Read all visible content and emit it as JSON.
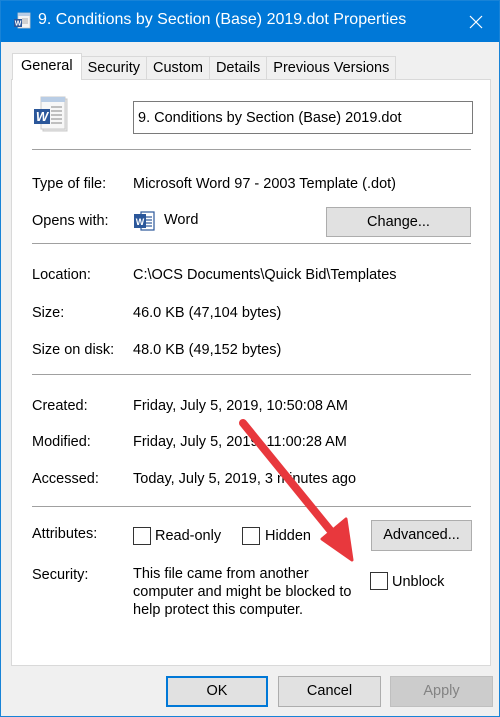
{
  "window": {
    "title": "9. Conditions by Section (Base) 2019.dot Properties",
    "app_icon": "word-document-icon",
    "close_icon": "close-icon"
  },
  "tabs": [
    {
      "label": "General",
      "active": true
    },
    {
      "label": "Security",
      "active": false
    },
    {
      "label": "Custom",
      "active": false
    },
    {
      "label": "Details",
      "active": false
    },
    {
      "label": "Previous Versions",
      "active": false
    }
  ],
  "general": {
    "file_name": "9. Conditions by Section (Base) 2019.dot",
    "type_of_file": {
      "label": "Type of file:",
      "value": "Microsoft Word 97 - 2003 Template (.dot)"
    },
    "opens_with": {
      "label": "Opens with:",
      "value": "Word",
      "change_button": "Change..."
    },
    "location": {
      "label": "Location:",
      "value": "C:\\OCS Documents\\Quick Bid\\Templates"
    },
    "size": {
      "label": "Size:",
      "value": "46.0 KB (47,104 bytes)"
    },
    "size_on_disk": {
      "label": "Size on disk:",
      "value": "48.0 KB (49,152 bytes)"
    },
    "created": {
      "label": "Created:",
      "value": "Friday, July 5, 2019, 10:50:08 AM"
    },
    "modified": {
      "label": "Modified:",
      "value": "Friday, July 5, 2019, 11:00:28 AM"
    },
    "accessed": {
      "label": "Accessed:",
      "value": "Today, July 5, 2019, 3 minutes ago"
    },
    "attributes": {
      "label": "Attributes:",
      "read_only": {
        "label": "Read-only",
        "checked": false
      },
      "hidden": {
        "label": "Hidden",
        "checked": false
      },
      "advanced_button": "Advanced..."
    },
    "security": {
      "label": "Security:",
      "text": "This file came from another computer and might be blocked to help protect this computer.",
      "unblock": {
        "label": "Unblock",
        "checked": false
      }
    }
  },
  "footer": {
    "ok": "OK",
    "cancel": "Cancel",
    "apply": "Apply",
    "apply_disabled": true
  },
  "annotation": {
    "arrow_color": "#e8383d",
    "points_to": "Unblock checkbox"
  },
  "colors": {
    "titlebar": "#0078d7",
    "word_blue": "#2b579a"
  }
}
